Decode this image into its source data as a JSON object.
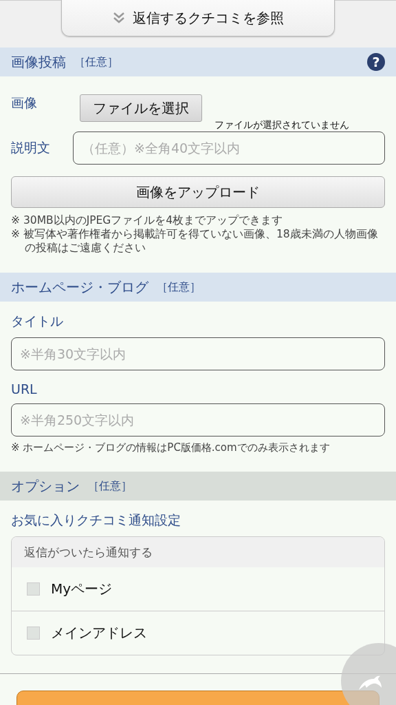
{
  "reply_link": {
    "label": "返信するクチコミを参照"
  },
  "image_section": {
    "title": "画像投稿",
    "tag": "［任意］",
    "help": "?",
    "image_label": "画像",
    "file_button": "ファイルを選択",
    "file_status": "ファイルが選択されていません",
    "caption_label": "説明文",
    "caption_placeholder": "（任意）※全角40文字以内",
    "upload_button": "画像をアップロード",
    "notes": [
      "※ 30MB以内のJPEGファイルを4枚までアップできます",
      "※ 被写体や著作権者から掲載許可を得ていない画像、18歳未満の人物画像の投稿はご遠慮ください"
    ]
  },
  "homepage_section": {
    "title": "ホームページ・ブログ",
    "tag": "［任意］",
    "fields": [
      {
        "label": "タイトル",
        "placeholder": "※半角30文字以内"
      },
      {
        "label": "URL",
        "placeholder": "※半角250文字以内"
      }
    ],
    "note": "※ ホームページ・ブログの情報はPC版価格.comでのみ表示されます"
  },
  "option_section": {
    "title": "オプション",
    "tag": "［任意］",
    "subtitle": "お気に入りクチコミ通知設定",
    "group_title": "返信がついたら通知する",
    "options": [
      {
        "label": "Myページ",
        "checked": false
      },
      {
        "label": "メインアドレス",
        "checked": false
      }
    ]
  }
}
